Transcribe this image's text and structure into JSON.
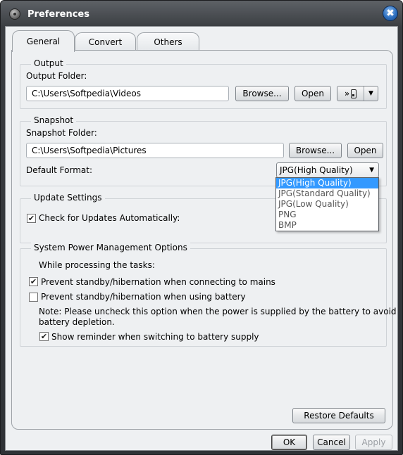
{
  "window": {
    "title": "Preferences"
  },
  "tabs": [
    {
      "label": "General",
      "active": true
    },
    {
      "label": "Convert",
      "active": false
    },
    {
      "label": "Others",
      "active": false
    }
  ],
  "output": {
    "group_label": "Output",
    "folder_label": "Output Folder:",
    "folder_value": "C:\\Users\\Softpedia\\Videos",
    "browse_label": "Browse...",
    "open_label": "Open",
    "device_button_glyph": "»"
  },
  "snapshot": {
    "group_label": "Snapshot",
    "folder_label": "Snapshot Folder:",
    "folder_value": "C:\\Users\\Softpedia\\Pictures",
    "browse_label": "Browse...",
    "open_label": "Open",
    "format_label": "Default Format:",
    "format_value": "JPG(High Quality)",
    "format_options": [
      "JPG(High Quality)",
      "JPG(Standard Quality)",
      "JPG(Low Quality)",
      "PNG",
      "BMP"
    ]
  },
  "update": {
    "group_label": "Update Settings",
    "check_label": "Check for Updates Automatically:",
    "check_checked": true
  },
  "power": {
    "group_label": "System Power Management Options",
    "intro": "While processing the tasks:",
    "mains_label": "Prevent standby/hibernation when connecting to mains",
    "mains_checked": true,
    "battery_label": "Prevent standby/hibernation when using battery",
    "battery_checked": false,
    "note_line1": "Note: Please uncheck this option when the power is supplied by the battery to avoid",
    "note_line2": "battery depletion.",
    "reminder_label": "Show reminder when switching to battery supply",
    "reminder_checked": true
  },
  "buttons": {
    "restore_defaults": "Restore Defaults",
    "ok": "OK",
    "cancel": "Cancel",
    "apply": "Apply"
  },
  "icons": {
    "app": "app-icon",
    "close": "close-icon",
    "check_mark": "✔",
    "close_glyph": "✖",
    "dropdown_arrow": "▼"
  },
  "colors": {
    "titlebar": "#3a3d41",
    "client": "#eef0f2",
    "selection": "#3399ff",
    "close_button": "#2d6fbf"
  }
}
